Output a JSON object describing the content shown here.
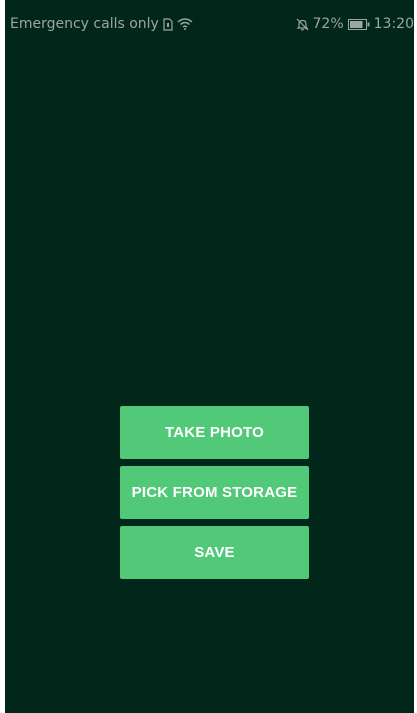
{
  "status_bar": {
    "carrier": "Emergency calls only",
    "battery_percent": "72%",
    "time": "13:20",
    "icons": [
      "sim-icon",
      "wifi-icon",
      "notifications-off-icon",
      "battery-icon"
    ]
  },
  "actions": {
    "take_photo": "TAKE PHOTO",
    "pick_from_storage": "PICK FROM STORAGE",
    "save": "SAVE"
  },
  "colors": {
    "background": "#01261a",
    "button": "#52c879",
    "button_text": "#ffffff",
    "status_text": "#9aa89f"
  }
}
